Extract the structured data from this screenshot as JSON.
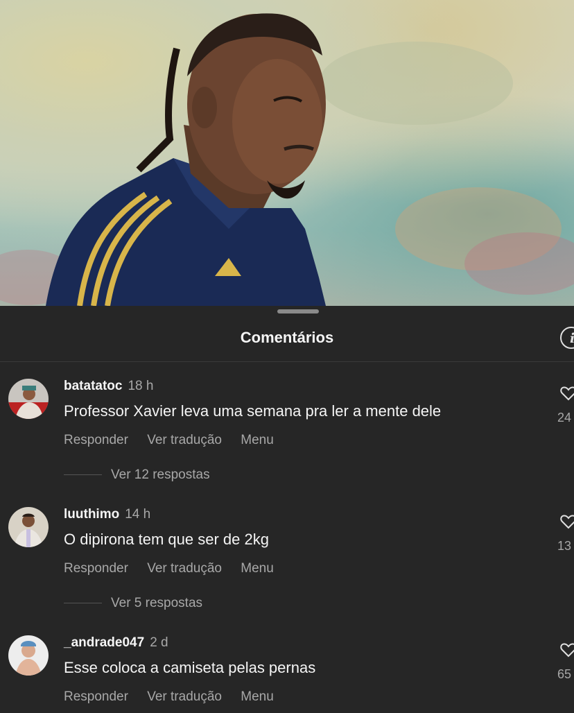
{
  "sheet": {
    "title": "Comentários"
  },
  "comments": [
    {
      "username": "batatatoc",
      "time": "18 h",
      "text": "Professor Xavier leva uma semana pra ler a mente dele",
      "likes": "24",
      "replies": "Ver 12 respostas"
    },
    {
      "username": "luuthimo",
      "time": "14 h",
      "text": "O dipirona tem que ser de 2kg",
      "likes": "13",
      "replies": "Ver 5 respostas"
    },
    {
      "username": "_andrade047",
      "time": "2 d",
      "text": "Esse coloca a camiseta pelas pernas",
      "likes": "65"
    }
  ],
  "actions": {
    "reply": "Responder",
    "translate": "Ver tradução",
    "menu": "Menu"
  },
  "colors": {
    "background": "#262626",
    "secondary_text": "#a8a8a8",
    "primary_text": "#f5f5f5"
  }
}
